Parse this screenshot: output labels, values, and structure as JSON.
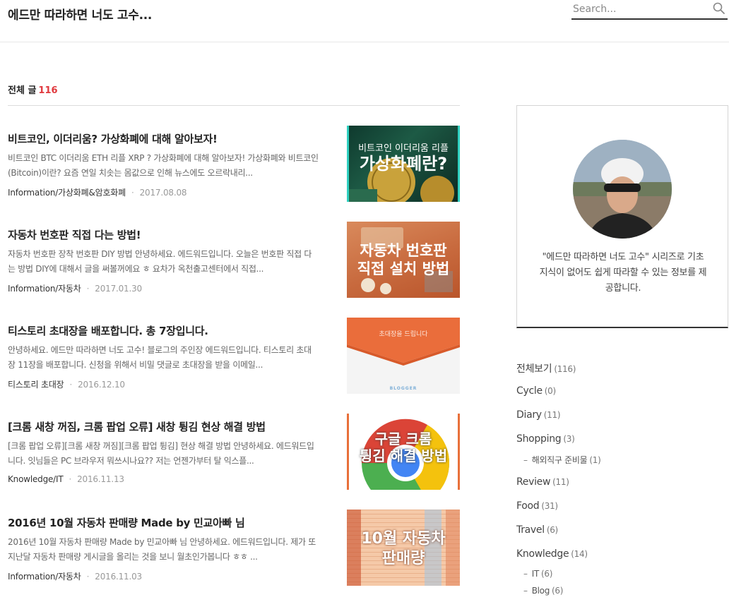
{
  "site": {
    "title": "에드만 따라하면 너도 고수..."
  },
  "search": {
    "placeholder": "Search..."
  },
  "list": {
    "label": "전체 글",
    "count": "116"
  },
  "posts": [
    {
      "title": "비트코인, 이더리움? 가상화폐에 대해 알아보자!",
      "excerpt": "비트코인 BTC 이더리움 ETH 리플 XRP ? 가상화폐에 대해 알아보자! 가상화폐와 비트코인(Bitcoin)이란? 요즘 연일 치솟는 몸값으로 인해 뉴스에도 오르락내리...",
      "category": "Information/가상화폐&암호화폐",
      "date": "2017.08.08",
      "thumb_lines": [
        "비트코인 이더리움 리플",
        "가상화폐란?"
      ]
    },
    {
      "title": "자동차 번호판 직접 다는 방법!",
      "excerpt": "자동차 번호판 장착 번호판 DIY 방법 안녕하세요. 에드워드입니다. 오늘은 번호판 직접 다는 방법 DIY에 대해서 글을 써볼꺼에요 ㅎ 요차가 옥천출고센터에서 직접...",
      "category": "Information/자동차",
      "date": "2017.01.30",
      "thumb_lines": [
        "자동차 번호판",
        "직접 설치 방법"
      ]
    },
    {
      "title": "티스토리 초대장을 배포합니다. 총 7장입니다.",
      "excerpt": "안녕하세요. 에드만 따라하면 너도 고수! 블로그의 주인장 에드워드입니다. 티스토리 초대장 11장을 배포합니다. 신청을 위해서 비밀 댓글로 초대장을 받을 이메일...",
      "category": "티스토리 초대장",
      "date": "2016.12.10",
      "thumb_lines": [
        "초대장을 드립니다",
        "BLOGGER"
      ]
    },
    {
      "title": "[크롬 새창 꺼짐, 크롬 팝업 오류] 새창 튕김 현상 해결 방법",
      "excerpt": "[크롬 팝업 오류][크롬 새창 꺼짐][크롬 팝업 튕김] 현상 해결 방법 안녕하세요. 에드워드입니다. 잇님들은 PC 브라우저 뭐쓰시나요?? 저는 언젠가부터 탈 익스플...",
      "category": "Knowledge/IT",
      "date": "2016.11.13",
      "thumb_lines": [
        "구글 크롬",
        "튕김 해결 방법"
      ]
    },
    {
      "title": "2016년 10월 자동차 판매량 Made by 민교아빠 님",
      "excerpt": "2016년 10월 자동차 판매량 Made by 민교아빠 님 안녕하세요. 에드워드입니다. 제가 또 지난달 자동차 판매량 게시글을 올리는 것을 보니 월초인가봅니다 ㅎㅎ ...",
      "category": "Information/자동차",
      "date": "2016.11.03",
      "thumb_lines": [
        "10월 자동차",
        "판매량"
      ]
    }
  ],
  "profile": {
    "description": "\"에드만 따라하면 너도 고수\" 시리즈로 기초 지식이 없어도 쉽게 따라할 수 있는 정보를 제공합니다."
  },
  "categories": [
    {
      "label": "전체보기",
      "count": "(116)"
    },
    {
      "label": "Cycle",
      "count": "(0)"
    },
    {
      "label": "Diary",
      "count": "(11)"
    },
    {
      "label": "Shopping",
      "count": "(3)"
    },
    {
      "label": "해외직구 준비물",
      "count": "(1)"
    },
    {
      "label": "Review",
      "count": "(11)"
    },
    {
      "label": "Food",
      "count": "(31)"
    },
    {
      "label": "Travel",
      "count": "(6)"
    },
    {
      "label": "Knowledge",
      "count": "(14)"
    },
    {
      "label": "IT",
      "count": "(6)"
    },
    {
      "label": "Blog",
      "count": "(6)"
    }
  ],
  "colors": {
    "accent": "#e0393e",
    "text": "#222222",
    "muted": "#999999"
  }
}
